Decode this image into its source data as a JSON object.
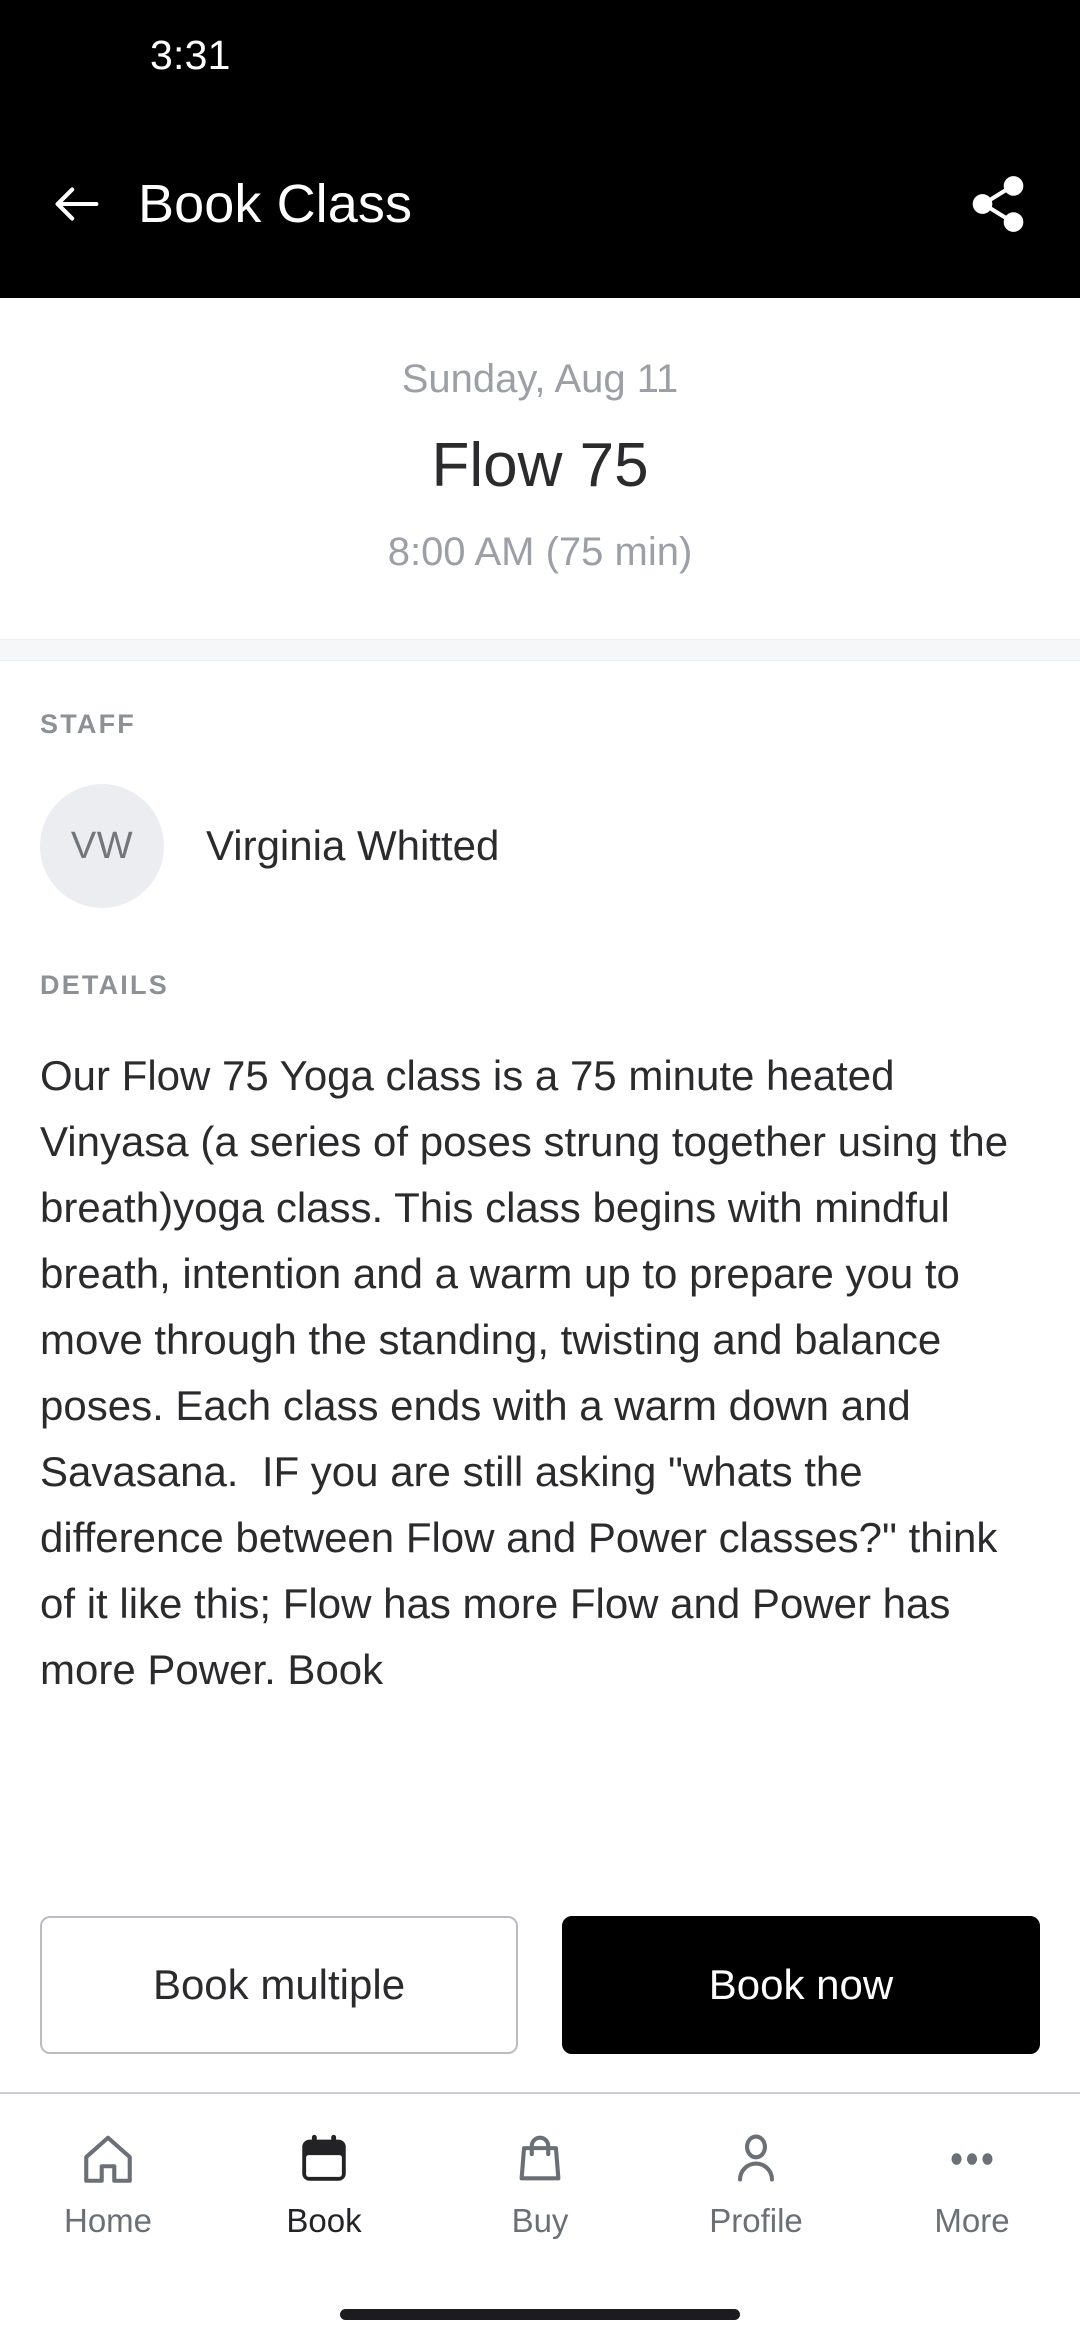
{
  "status_bar": {
    "time": "3:31"
  },
  "app_bar": {
    "title": "Book Class",
    "back_icon": "arrow-left-icon",
    "share_icon": "share-icon"
  },
  "class_header": {
    "date": "Sunday, Aug 11",
    "name": "Flow 75",
    "time": "8:00 AM (75 min)"
  },
  "staff": {
    "label": "STAFF",
    "initials": "VW",
    "name": "Virginia Whitted"
  },
  "details": {
    "label": "DETAILS",
    "body": "Our Flow 75 Yoga class is a 75 minute heated Vinyasa (a series of poses strung together using the breath)yoga class. This class begins with mindful breath, intention and a warm up to prepare you to move through the standing, twisting and balance poses. Each class ends with a warm down and Savasana.  IF you are still asking \"whats the difference between Flow and Power classes?\" think of it like this; Flow has more Flow and Power has more Power. Book"
  },
  "actions": {
    "book_multiple_label": "Book multiple",
    "book_now_label": "Book now"
  },
  "bottom_nav": {
    "items": [
      {
        "label": "Home",
        "icon": "home-icon",
        "active": false
      },
      {
        "label": "Book",
        "icon": "calendar-icon",
        "active": true
      },
      {
        "label": "Buy",
        "icon": "shopping-bag-icon",
        "active": false
      },
      {
        "label": "Profile",
        "icon": "person-icon",
        "active": false
      },
      {
        "label": "More",
        "icon": "ellipsis-icon",
        "active": false
      }
    ]
  },
  "colors": {
    "app_bar_bg": "#000000",
    "accent": "#000000",
    "muted_text": "#9ca0a6",
    "body_text": "#2b2b2d",
    "divider": "#f5f7f9"
  }
}
